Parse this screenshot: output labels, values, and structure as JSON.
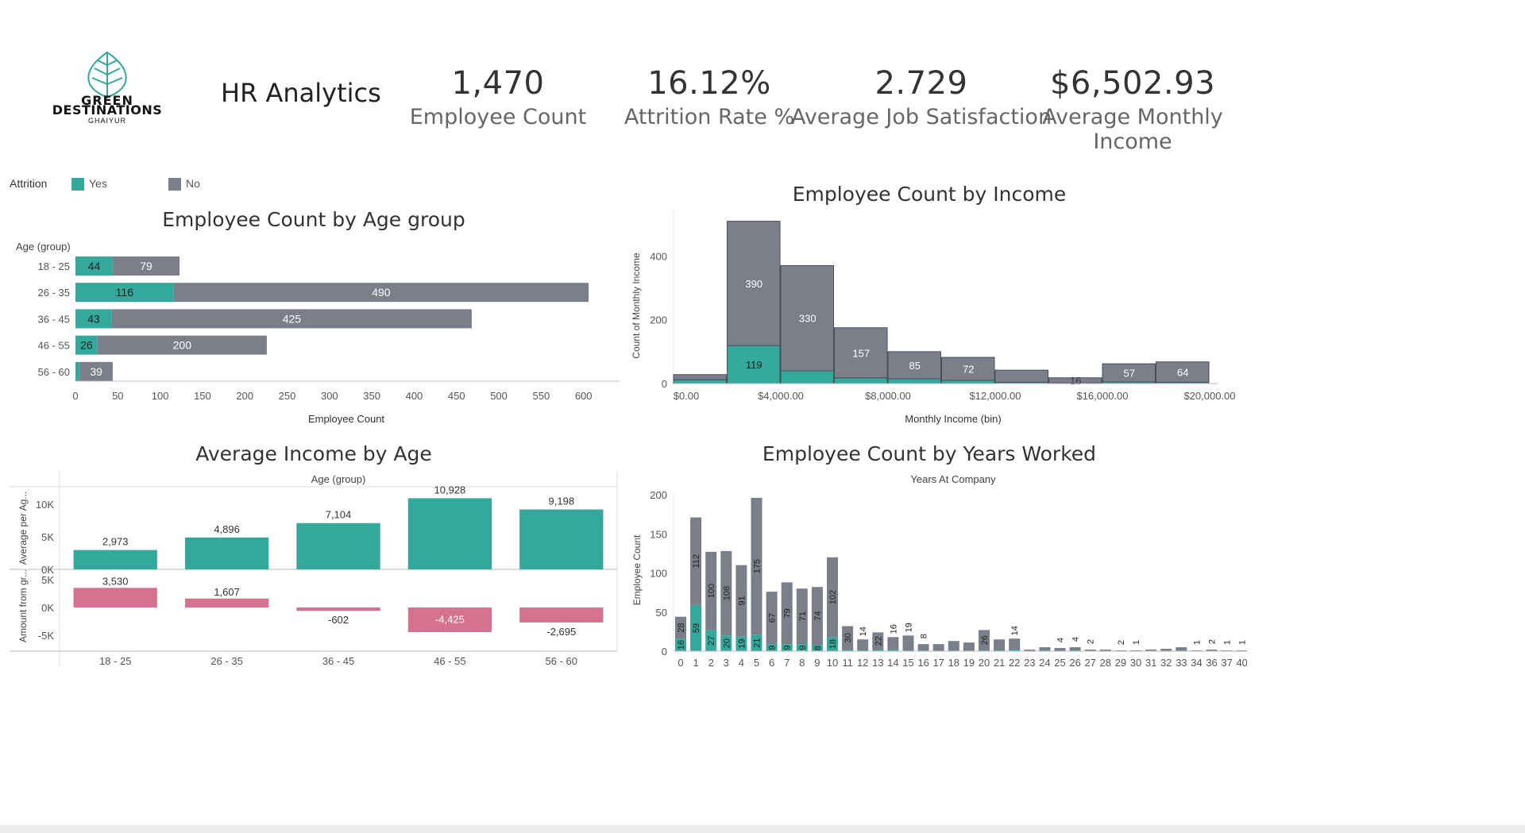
{
  "colors": {
    "yes": "#34a89a",
    "no": "#7a7f8a",
    "neg": "#d4728f",
    "axis": "#bbbbbb"
  },
  "logo": {
    "line1": "GREEN",
    "line2": "DESTINATIONS",
    "line3": "GHAIYUR"
  },
  "header": {
    "title": "HR Analytics"
  },
  "kpis": [
    {
      "value": "1,470",
      "label": "Employee Count"
    },
    {
      "value": "16.12%",
      "label": "Attrition Rate %"
    },
    {
      "value": "2.729",
      "label": "Average Job Satisfaction"
    },
    {
      "value": "$6,502.93",
      "label": "Average Monthly Income"
    }
  ],
  "legend": {
    "title": "Attrition",
    "yes": "Yes",
    "no": "No"
  },
  "chart_data": [
    {
      "type": "bar",
      "title": "Employee Count by Age group",
      "row_header": "Age (group)",
      "xlabel": "Employee Count",
      "categories": [
        "18 - 25",
        "26 - 35",
        "36 - 45",
        "46 - 55",
        "56 - 60"
      ],
      "series": [
        {
          "name": "Yes",
          "values": [
            44,
            116,
            43,
            26,
            5
          ],
          "labels": [
            "44",
            "116",
            "43",
            "26",
            ""
          ]
        },
        {
          "name": "No",
          "values": [
            79,
            490,
            425,
            200,
            39
          ],
          "labels": [
            "79",
            "490",
            "425",
            "200",
            "39"
          ]
        }
      ],
      "xticks": [
        "0",
        "50",
        "100",
        "150",
        "200",
        "250",
        "300",
        "350",
        "400",
        "450",
        "500",
        "550",
        "600"
      ],
      "xlim": [
        0,
        630
      ]
    },
    {
      "type": "bar",
      "title": "Employee Count by Income",
      "xlabel": "Monthly Income (bin)",
      "ylabel": "Count of Monthly Income",
      "bins": [
        0,
        2000,
        4000,
        6000,
        8000,
        10000,
        12000,
        14000,
        16000,
        18000,
        20000
      ],
      "series": [
        {
          "name": "Yes",
          "values": [
            12,
            119,
            40,
            18,
            15,
            10,
            4,
            2,
            5,
            4
          ],
          "labels": [
            "",
            "119",
            "",
            "",
            "",
            "",
            "",
            "",
            "",
            ""
          ]
        },
        {
          "name": "No",
          "values": [
            16,
            390,
            330,
            157,
            85,
            72,
            38,
            16,
            57,
            64
          ],
          "labels": [
            "",
            "390",
            "330",
            "157",
            "85",
            "72",
            "",
            "16",
            "57",
            "64"
          ]
        }
      ],
      "yticks": [
        "0",
        "200",
        "400"
      ],
      "xticks": [
        "$0.00",
        "$4,000.00",
        "$8,000.00",
        "$12,000.00",
        "$16,000.00",
        "$20,000.00"
      ],
      "ylim": [
        0,
        560
      ]
    },
    {
      "type": "bar",
      "title": "Average Income by Age",
      "column_header": "Age (group)",
      "ylabel_top": "Average per Ag...",
      "ylabel_bottom": "Amount from gr...",
      "categories": [
        "18 - 25",
        "26 - 35",
        "36 - 45",
        "46 - 55",
        "56 - 60"
      ],
      "average": [
        2973,
        4896,
        7104,
        10928,
        9198
      ],
      "average_labels": [
        "2,973",
        "4,896",
        "7,104",
        "10,928",
        "9,198"
      ],
      "difference": [
        3530,
        1607,
        -602,
        -4425,
        -2695
      ],
      "difference_labels": [
        "3,530",
        "1,607",
        "-602",
        "-4,425",
        "-2,695"
      ],
      "yticks_top": [
        "0K",
        "5K",
        "10K"
      ],
      "yticks_bottom": [
        "-5K",
        "0K",
        "5K"
      ]
    },
    {
      "type": "bar",
      "title": "Employee Count by Years Worked",
      "column_header": "Years At Company",
      "ylabel": "Employee Count",
      "categories": [
        "0",
        "1",
        "2",
        "3",
        "4",
        "5",
        "6",
        "7",
        "8",
        "9",
        "10",
        "11",
        "12",
        "13",
        "14",
        "15",
        "16",
        "17",
        "18",
        "19",
        "20",
        "21",
        "22",
        "23",
        "24",
        "25",
        "26",
        "27",
        "28",
        "29",
        "30",
        "31",
        "32",
        "33",
        "34",
        "36",
        "37",
        "40"
      ],
      "series": [
        {
          "name": "Yes",
          "values": [
            16,
            59,
            27,
            20,
            19,
            21,
            9,
            9,
            9,
            8,
            18,
            2,
            1,
            2,
            2,
            1,
            1,
            0,
            1,
            0,
            1,
            1,
            2,
            0,
            1,
            0,
            1,
            0,
            0,
            0,
            0,
            0,
            0,
            1,
            0,
            0,
            0,
            0
          ],
          "labels": [
            "16",
            "59",
            "27",
            "20",
            "19",
            "21",
            "9",
            "9",
            "9",
            "8",
            "18",
            "",
            "",
            "",
            "",
            "",
            "",
            "",
            "",
            "",
            "",
            "",
            "",
            "",
            "",
            "",
            "",
            "",
            "",
            "",
            "",
            "",
            "",
            "",
            "",
            "",
            "",
            ""
          ]
        },
        {
          "name": "No",
          "values": [
            28,
            112,
            100,
            108,
            91,
            175,
            67,
            79,
            71,
            74,
            102,
            30,
            14,
            22,
            16,
            19,
            8,
            9,
            12,
            11,
            26,
            14,
            14,
            2,
            4,
            4,
            4,
            2,
            2,
            1,
            1,
            2,
            3,
            4,
            1,
            2,
            1,
            1
          ],
          "labels": [
            "28",
            "112",
            "100",
            "108",
            "91",
            "175",
            "67",
            "79",
            "71",
            "74",
            "102",
            "30",
            "14",
            "22",
            "16",
            "19",
            "8",
            "",
            "",
            "",
            "26",
            "",
            "14",
            "",
            "",
            "4",
            "4",
            "2",
            "",
            "2",
            "1",
            "",
            "",
            "",
            "1",
            "2",
            "1",
            "1"
          ]
        }
      ],
      "yticks": [
        "0",
        "50",
        "100",
        "150",
        "200"
      ],
      "ylim": [
        0,
        220
      ]
    }
  ]
}
